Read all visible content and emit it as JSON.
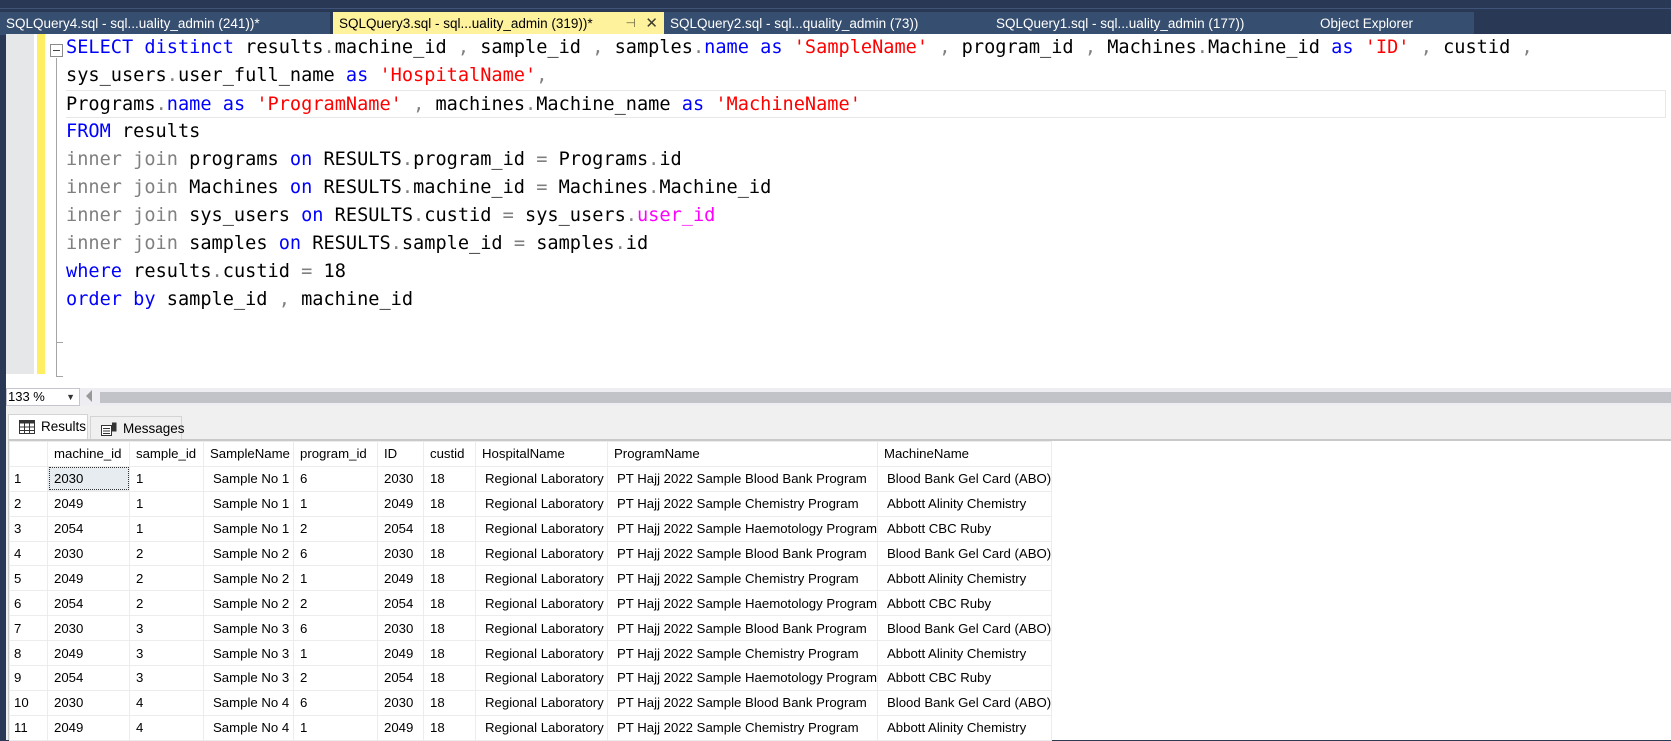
{
  "tabs": [
    {
      "label": "SQLQuery4.sql - sql...uality_admin (241))*",
      "active": false
    },
    {
      "label": "SQLQuery3.sql - sql...uality_admin (319))*",
      "active": true
    },
    {
      "label": "SQLQuery2.sql - sql...quality_admin (73))",
      "active": false
    },
    {
      "label": "SQLQuery1.sql - sql...uality_admin (177))",
      "active": false
    },
    {
      "label": "Object Explorer",
      "active": false
    }
  ],
  "tab_icons": {
    "pin": "⊣",
    "close": "✕"
  },
  "editor": {
    "lines": [
      [
        {
          "t": "SELECT",
          "c": "kw"
        },
        {
          "t": " "
        },
        {
          "t": "distinct",
          "c": "kw"
        },
        {
          "t": " results"
        },
        {
          "t": ".",
          "c": "gray"
        },
        {
          "t": "machine_id "
        },
        {
          "t": ",",
          "c": "gray"
        },
        {
          "t": " sample_id "
        },
        {
          "t": ",",
          "c": "gray"
        },
        {
          "t": " samples"
        },
        {
          "t": ".",
          "c": "gray"
        },
        {
          "t": "name",
          "c": "kw"
        },
        {
          "t": " "
        },
        {
          "t": "as",
          "c": "kw"
        },
        {
          "t": " "
        },
        {
          "t": "'SampleName'",
          "c": "str"
        },
        {
          "t": " "
        },
        {
          "t": ",",
          "c": "gray"
        },
        {
          "t": " program_id "
        },
        {
          "t": ",",
          "c": "gray"
        },
        {
          "t": " Machines"
        },
        {
          "t": ".",
          "c": "gray"
        },
        {
          "t": "Machine_id "
        },
        {
          "t": "as",
          "c": "kw"
        },
        {
          "t": " "
        },
        {
          "t": "'ID'",
          "c": "str"
        },
        {
          "t": " "
        },
        {
          "t": ",",
          "c": "gray"
        },
        {
          "t": " custid "
        },
        {
          "t": ",",
          "c": "gray"
        }
      ],
      [
        {
          "t": "sys_users"
        },
        {
          "t": ".",
          "c": "gray"
        },
        {
          "t": "user_full_name "
        },
        {
          "t": "as",
          "c": "kw"
        },
        {
          "t": " "
        },
        {
          "t": "'HospitalName'",
          "c": "str"
        },
        {
          "t": ",",
          "c": "gray"
        }
      ],
      [
        {
          "t": "Programs"
        },
        {
          "t": ".",
          "c": "gray"
        },
        {
          "t": "name",
          "c": "kw"
        },
        {
          "t": " "
        },
        {
          "t": "as",
          "c": "kw"
        },
        {
          "t": " "
        },
        {
          "t": "'ProgramName'",
          "c": "str"
        },
        {
          "t": " "
        },
        {
          "t": ",",
          "c": "gray"
        },
        {
          "t": " machines"
        },
        {
          "t": ".",
          "c": "gray"
        },
        {
          "t": "Machine_name "
        },
        {
          "t": "as",
          "c": "kw"
        },
        {
          "t": " "
        },
        {
          "t": "'MachineName'",
          "c": "str"
        }
      ],
      [
        {
          "t": "FROM",
          "c": "kw"
        },
        {
          "t": " results"
        }
      ],
      [
        {
          "t": "inner join",
          "c": "gray"
        },
        {
          "t": " programs "
        },
        {
          "t": "on",
          "c": "kw"
        },
        {
          "t": " RESULTS"
        },
        {
          "t": ".",
          "c": "gray"
        },
        {
          "t": "program_id "
        },
        {
          "t": "=",
          "c": "gray"
        },
        {
          "t": " Programs"
        },
        {
          "t": ".",
          "c": "gray"
        },
        {
          "t": "id"
        }
      ],
      [
        {
          "t": "inner join",
          "c": "gray"
        },
        {
          "t": " Machines "
        },
        {
          "t": "on",
          "c": "kw"
        },
        {
          "t": " RESULTS"
        },
        {
          "t": ".",
          "c": "gray"
        },
        {
          "t": "machine_id "
        },
        {
          "t": "=",
          "c": "gray"
        },
        {
          "t": " Machines"
        },
        {
          "t": ".",
          "c": "gray"
        },
        {
          "t": "Machine_id"
        }
      ],
      [
        {
          "t": "inner join",
          "c": "gray"
        },
        {
          "t": " sys_users "
        },
        {
          "t": "on",
          "c": "kw"
        },
        {
          "t": " RESULTS"
        },
        {
          "t": ".",
          "c": "gray"
        },
        {
          "t": "custid "
        },
        {
          "t": "=",
          "c": "gray"
        },
        {
          "t": " sys_users"
        },
        {
          "t": ".",
          "c": "gray"
        },
        {
          "t": "user_id",
          "c": "mag"
        }
      ],
      [
        {
          "t": "inner join",
          "c": "gray"
        },
        {
          "t": " samples "
        },
        {
          "t": "on",
          "c": "kw"
        },
        {
          "t": " RESULTS"
        },
        {
          "t": ".",
          "c": "gray"
        },
        {
          "t": "sample_id "
        },
        {
          "t": "=",
          "c": "gray"
        },
        {
          "t": " samples"
        },
        {
          "t": ".",
          "c": "gray"
        },
        {
          "t": "id"
        }
      ],
      [
        {
          "t": "where",
          "c": "kw"
        },
        {
          "t": " results"
        },
        {
          "t": ".",
          "c": "gray"
        },
        {
          "t": "custid "
        },
        {
          "t": "=",
          "c": "gray"
        },
        {
          "t": " 18"
        }
      ],
      [
        {
          "t": "order by",
          "c": "kw"
        },
        {
          "t": " sample_id "
        },
        {
          "t": ",",
          "c": "gray"
        },
        {
          "t": " machine_id"
        }
      ]
    ],
    "current_line": 2
  },
  "zoom": {
    "value": "133 %"
  },
  "result_tabs": [
    {
      "label": "Results",
      "icon": "grid-icon",
      "active": true
    },
    {
      "label": "Messages",
      "icon": "messages-icon",
      "active": false
    }
  ],
  "grid": {
    "columns": [
      "",
      "machine_id",
      "sample_id",
      "SampleName",
      "program_id",
      "ID",
      "custid",
      "HospitalName",
      "ProgramName",
      "MachineName"
    ],
    "rows": [
      [
        "1",
        "2030",
        "1",
        "Sample No 1",
        "6",
        "2030",
        "18",
        "Regional Laboratory",
        "PT Hajj 2022 Sample Blood Bank Program",
        "Blood Bank Gel Card (ABO)"
      ],
      [
        "2",
        "2049",
        "1",
        "Sample No 1",
        "1",
        "2049",
        "18",
        "Regional Laboratory",
        "PT Hajj 2022 Sample Chemistry Program",
        "Abbott Alinity Chemistry"
      ],
      [
        "3",
        "2054",
        "1",
        "Sample No 1",
        "2",
        "2054",
        "18",
        "Regional Laboratory",
        "PT Hajj 2022 Sample Haemotology Program",
        "Abbott CBC Ruby"
      ],
      [
        "4",
        "2030",
        "2",
        "Sample No 2",
        "6",
        "2030",
        "18",
        "Regional Laboratory",
        "PT Hajj 2022 Sample Blood Bank Program",
        "Blood Bank Gel Card (ABO)"
      ],
      [
        "5",
        "2049",
        "2",
        "Sample No 2",
        "1",
        "2049",
        "18",
        "Regional Laboratory",
        "PT Hajj 2022 Sample Chemistry Program",
        "Abbott Alinity Chemistry"
      ],
      [
        "6",
        "2054",
        "2",
        "Sample No 2",
        "2",
        "2054",
        "18",
        "Regional Laboratory",
        "PT Hajj 2022 Sample Haemotology Program",
        "Abbott CBC Ruby"
      ],
      [
        "7",
        "2030",
        "3",
        "Sample No 3",
        "6",
        "2030",
        "18",
        "Regional Laboratory",
        "PT Hajj 2022 Sample Blood Bank Program",
        "Blood Bank Gel Card (ABO)"
      ],
      [
        "8",
        "2049",
        "3",
        "Sample No 3",
        "1",
        "2049",
        "18",
        "Regional Laboratory",
        "PT Hajj 2022 Sample Chemistry Program",
        "Abbott Alinity Chemistry"
      ],
      [
        "9",
        "2054",
        "3",
        "Sample No 3",
        "2",
        "2054",
        "18",
        "Regional Laboratory",
        "PT Hajj 2022 Sample Haemotology Program",
        "Abbott CBC Ruby"
      ],
      [
        "10",
        "2030",
        "4",
        "Sample No 4",
        "6",
        "2030",
        "18",
        "Regional Laboratory",
        "PT Hajj 2022 Sample Blood Bank Program",
        "Blood Bank Gel Card (ABO)"
      ],
      [
        "11",
        "2049",
        "4",
        "Sample No 4",
        "1",
        "2049",
        "18",
        "Regional Laboratory",
        "PT Hajj 2022 Sample Chemistry Program",
        "Abbott Alinity Chemistry"
      ]
    ],
    "selected_cell": {
      "row": 0,
      "col": 1
    }
  }
}
